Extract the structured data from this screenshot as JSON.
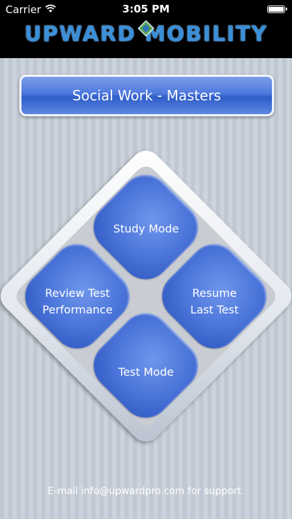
{
  "status_bar": {
    "carrier": "Carrier",
    "time": "3:05 PM"
  },
  "header": {
    "logo_text": "UPWARD MOBILITY"
  },
  "banner": {
    "title": "Social Work - Masters"
  },
  "menu": {
    "study_mode": "Study Mode",
    "review_test_performance": "Review Test\nPerformance",
    "resume_last_test": "Resume\nLast Test",
    "test_mode": "Test Mode"
  },
  "footer": {
    "support_text": "E-mail info@upwardpro.com for support."
  },
  "colors": {
    "tile_blue": "#4a74d9",
    "banner_blue": "#4d78dd",
    "header_bg": "#000000",
    "logo_blue": "#3a8fd8"
  },
  "icons": [
    "wifi-icon",
    "battery-icon",
    "logo-emblem-icon"
  ]
}
